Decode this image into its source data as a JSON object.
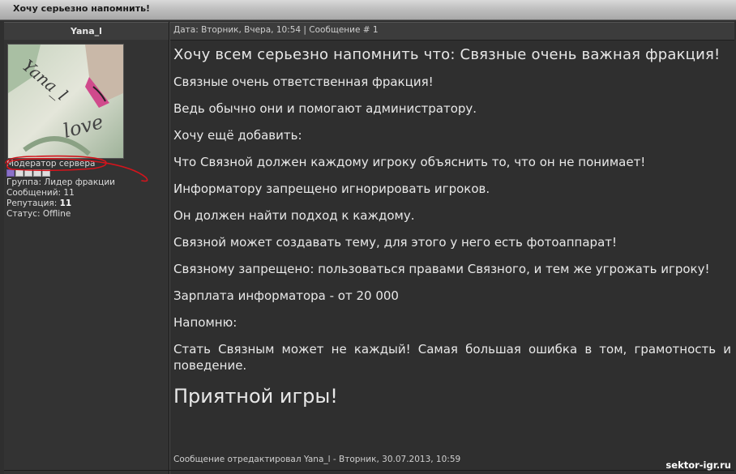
{
  "topic": {
    "title": "Хочу серьезно напомнить!"
  },
  "author": {
    "name": "Yana_l",
    "title": "Модератор сервера",
    "group": "Группа: Лидер фракции",
    "posts": "Сообщений: 11",
    "reputation_label": "Репутация: ",
    "reputation_value": "11",
    "status": "Статус: Offline",
    "avatar_text": "Yana_l",
    "avatar_text2": "love"
  },
  "post": {
    "meta": "Дата: Вторник, Вчера, 10:54 | Сообщение # 1",
    "paragraphs": [
      "Хочу всем серьезно напомнить что: Связные очень важная фракция!",
      "Связные очень ответственная фракция!",
      "Ведь обычно они и помогают администратору.",
      "Хочу ещё добавить:",
      "Что Связной должен каждому игроку объяснить то, что он не понимает!",
      "Информатору запрещено игнорировать игроков.",
      "Он должен найти подход к каждому.",
      "Связной может создавать тему, для этого у него есть фотоаппарат!",
      "Связному запрещено: пользоваться правами Связного, и тем же угрожать игроку!",
      "Зарплата информатора - от 20 000",
      "Напомню:",
      "Стать Связным может не каждый! Самая большая ошибка в том, грамотность и поведение.",
      "Приятной игры!"
    ],
    "edit_note": "Сообщение отредактировал Yana_l - Вторник, 30.07.2013, 10:59"
  },
  "watermark": "sektor-igr.ru",
  "colors": {
    "background": "#2f2f2f",
    "text": "#e8e8e8",
    "annotation": "#d4141c",
    "rank_pip": "#8a70c8"
  }
}
